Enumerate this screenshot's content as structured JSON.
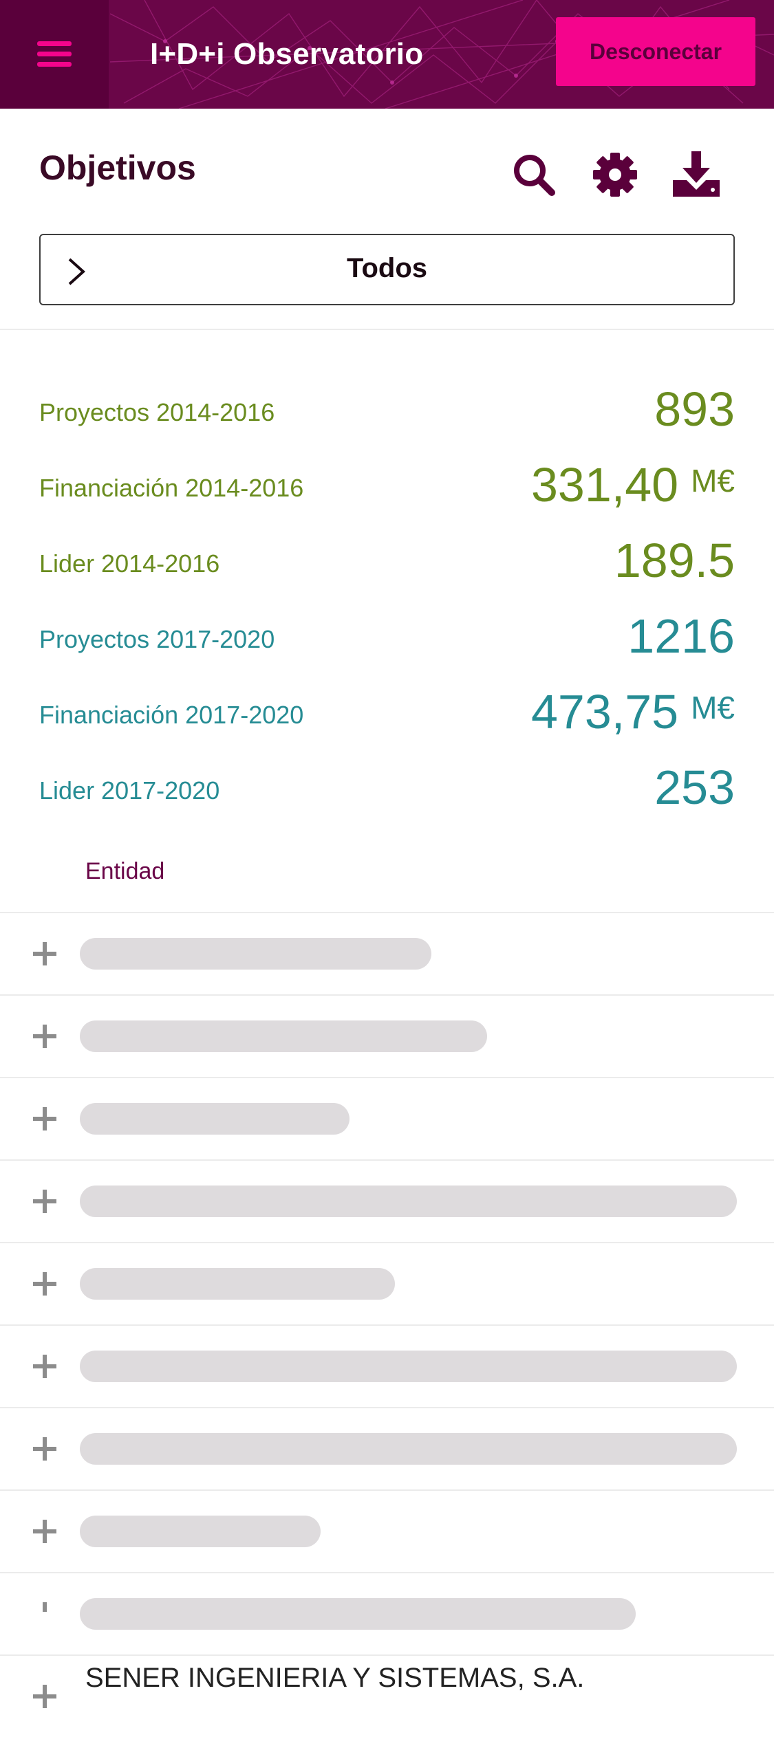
{
  "header": {
    "title": "I+D+i Observatorio",
    "logout_label": "Desconectar",
    "menu_icon": "hamburger-menu-icon"
  },
  "section": {
    "title": "Objetivos",
    "icons": [
      "search-icon",
      "gear-icon",
      "download-icon"
    ]
  },
  "filter": {
    "label": "Todos",
    "icon": "chevron-right-icon"
  },
  "stats": [
    {
      "label": "Proyectos 2014-2016",
      "value": "893",
      "unit": "",
      "color": "#6a8c1f"
    },
    {
      "label": "Financiación 2014-2016",
      "value": "331,40",
      "unit": "M€",
      "color": "#6a8c1f"
    },
    {
      "label": "Lider 2014-2016",
      "value": "189.5",
      "unit": "",
      "color": "#6a8c1f"
    },
    {
      "label": "Proyectos 2017-2020",
      "value": "1216",
      "unit": "",
      "color": "#268c94"
    },
    {
      "label": "Financiación 2017-2020",
      "value": "473,75",
      "unit": "M€",
      "color": "#268c94"
    },
    {
      "label": "Lider 2017-2020",
      "value": "253",
      "unit": "",
      "color": "#268c94"
    }
  ],
  "table": {
    "column_header": "Entidad",
    "rows_loading": 9,
    "last_row_text": "SENER INGENIERIA Y SISTEMAS, S.A."
  },
  "colors": {
    "primary": "#6a0648",
    "accent": "#f4048c",
    "green": "#6a8c1f",
    "teal": "#268c94",
    "skeleton": "#dedbdd"
  }
}
